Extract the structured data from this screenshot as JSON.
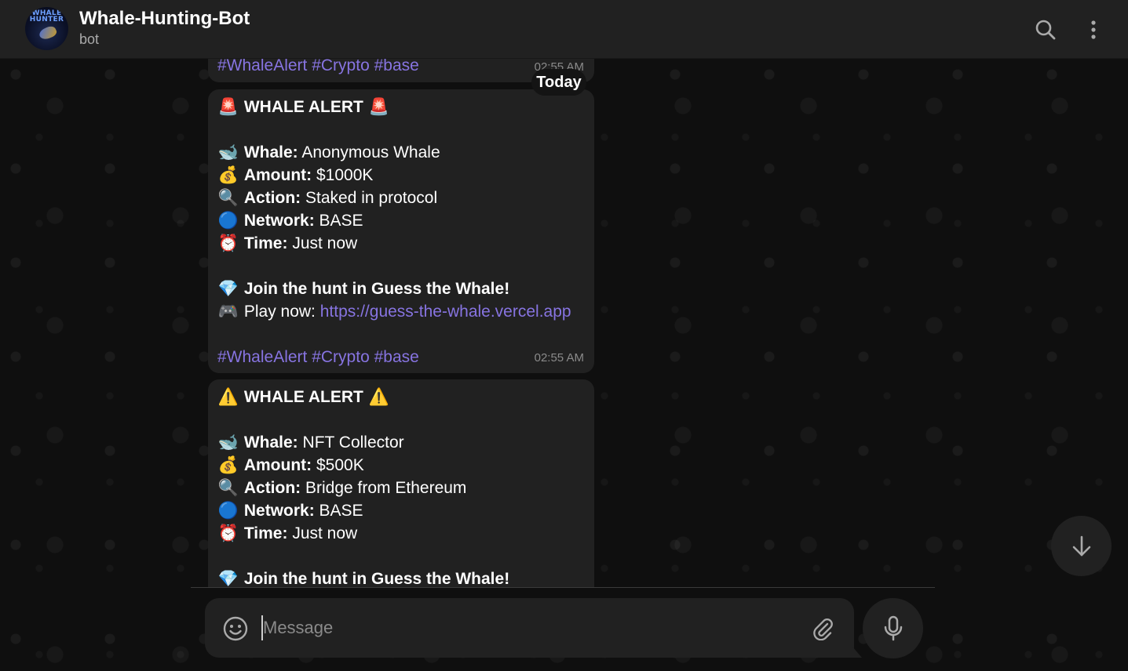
{
  "header": {
    "avatar_text": "WHALE\nHUNTER",
    "title": "Whale-Hunting-Bot",
    "status": "bot"
  },
  "date_pill": "Today",
  "messages": [
    {
      "partial": true,
      "hashtags": "#WhaleAlert #Crypto #base",
      "time": "02:55 AM"
    },
    {
      "alert_emoji": "🚨",
      "alert_title": "WHALE ALERT",
      "whale_label": "Whale:",
      "whale_value": " Anonymous Whale",
      "amount_label": "Amount:",
      "amount_value": " $1000K",
      "action_label": "Action:",
      "action_value": " Staked in protocol",
      "network_label": "Network:",
      "network_value": " BASE",
      "time_label": "Time:",
      "time_value": " Just now",
      "join_text": "Join the hunt in Guess the Whale!",
      "play_label": "Play now: ",
      "play_link": "https://guess-the-whale.vercel.app",
      "hashtags": "#WhaleAlert #Crypto #base",
      "time": "02:55 AM"
    },
    {
      "alert_emoji": "⚠️",
      "alert_title": "WHALE ALERT",
      "whale_label": "Whale:",
      "whale_value": " NFT Collector",
      "amount_label": "Amount:",
      "amount_value": " $500K",
      "action_label": "Action:",
      "action_value": " Bridge from Ethereum",
      "network_label": "Network:",
      "network_value": " BASE",
      "time_label": "Time:",
      "time_value": " Just now",
      "join_text": "Join the hunt in Guess the Whale!"
    }
  ],
  "emojis": {
    "whale": "🐋",
    "money": "💰",
    "magnifier": "🔍",
    "blue_circle": "🔵",
    "alarm": "⏰",
    "diamond": "💎",
    "gamepad": "🎮"
  },
  "composer": {
    "placeholder": "Message"
  },
  "icons": {
    "search": "search-icon",
    "menu": "more-vertical-icon",
    "emoji": "smile-icon",
    "attach": "paperclip-icon",
    "mic": "microphone-icon",
    "scroll": "arrow-down-icon"
  },
  "colors": {
    "accent": "#8774e1",
    "bubble": "#212121",
    "header": "#212121",
    "background": "#0f0f0f"
  }
}
